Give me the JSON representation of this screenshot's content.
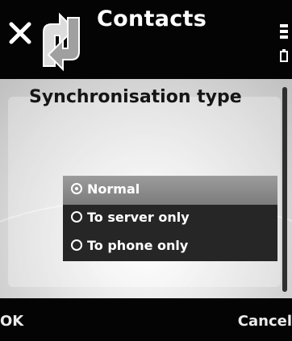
{
  "header": {
    "title": "Contacts",
    "close_icon": "close-icon",
    "app_icon": "sync-arrows-icon",
    "status_icon": "signal-battery-icon"
  },
  "dialog": {
    "title": "Synchronisation type",
    "options": [
      {
        "label": "Normal",
        "selected": true
      },
      {
        "label": "To server only",
        "selected": false
      },
      {
        "label": "To phone only",
        "selected": false
      }
    ]
  },
  "softkeys": {
    "left": "OK",
    "right": "Cancel"
  }
}
